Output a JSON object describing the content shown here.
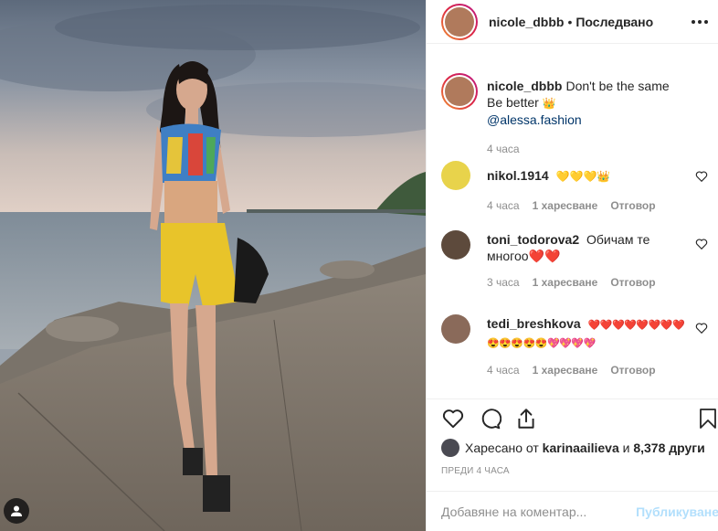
{
  "post": {
    "author": "nicole_dbbb",
    "follow_status": "Последвано",
    "caption_line1": "Don't be the same",
    "caption_line2": "Be better",
    "caption_emoji": "👑",
    "caption_mention": "@alessa.fashion",
    "caption_time": "4 часа",
    "colors": {
      "link": "#003569",
      "muted": "#8e8e8e",
      "publish": "#b2dffc"
    }
  },
  "comments": [
    {
      "username": "nikol.1914",
      "text": "💛💛💛👑",
      "time": "4 часа",
      "likes": "1 харесване",
      "reply": "Отговор"
    },
    {
      "username": "toni_todorova2",
      "text": "Обичам те многоо❤️❤️",
      "time": "3 часа",
      "likes": "1 харесване",
      "reply": "Отговор"
    },
    {
      "username": "tedi_breshkova",
      "text": "❤️❤️❤️❤️❤️❤️❤️❤️😍😍😍😍😍💖💖💖💖",
      "time": "4 часа",
      "likes": "1 харесване",
      "reply": "Отговор"
    }
  ],
  "likes_line": {
    "prefix": "Харесано от",
    "user": "karinaailieva",
    "conj": "и",
    "others": "8,378 други"
  },
  "post_time": "ПРЕДИ 4 ЧАСА",
  "comment_box": {
    "placeholder": "Добавяне на коментар...",
    "publish_label": "Публикуване"
  },
  "icons": [
    "more-icon",
    "heart-icon",
    "comment-icon",
    "share-icon",
    "bookmark-icon",
    "user-tag-icon"
  ]
}
